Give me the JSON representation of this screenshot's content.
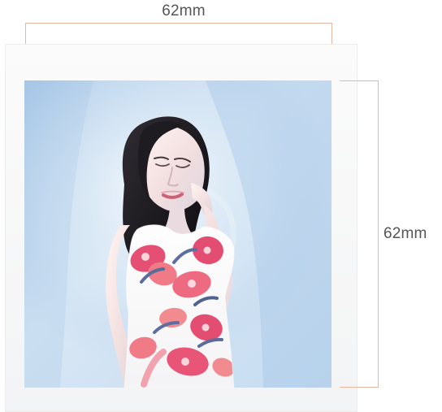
{
  "dimensions": {
    "width_label": "62mm",
    "height_label": "62mm"
  },
  "photo": {
    "subject": "woman-portrait"
  },
  "colors": {
    "dimension_line": "#e7b79f",
    "label_text": "#555555",
    "background_blue": "#c9ddf1",
    "dress_pink": "#e54f74"
  }
}
